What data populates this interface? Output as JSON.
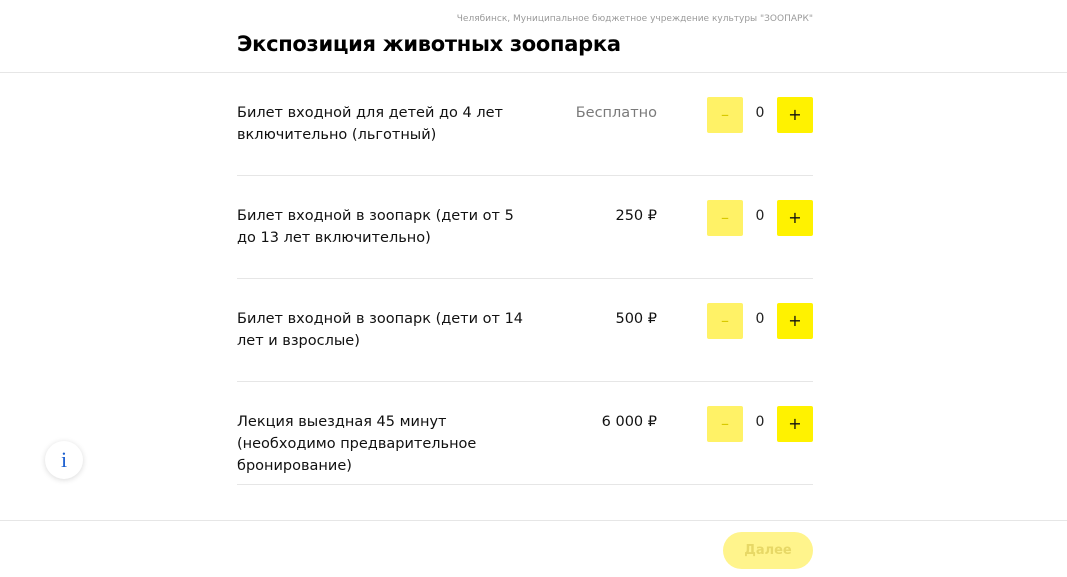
{
  "header": {
    "organization": "Челябинск, Муниципальное бюджетное учреждение культуры \"ЗООПАРК\"",
    "title": "Экспозиция животных зоопарка"
  },
  "tickets": [
    {
      "name": "Билет входной для детей до 4 лет включительно (льготный)",
      "price": "Бесплатно",
      "quantity": "0",
      "minus_label": "–",
      "plus_label": "+"
    },
    {
      "name": "Билет входной в зоопарк (дети от 5 до 13 лет включительно)",
      "price": "250 ₽",
      "quantity": "0",
      "minus_label": "–",
      "plus_label": "+"
    },
    {
      "name": "Билет входной в зоопарк (дети от 14 лет и взрослые)",
      "price": "500 ₽",
      "quantity": "0",
      "minus_label": "–",
      "plus_label": "+"
    },
    {
      "name": "Лекция выездная 45 минут (необходимо предварительное бронирование)",
      "price": "6 000 ₽",
      "quantity": "0",
      "minus_label": "–",
      "plus_label": "+"
    }
  ],
  "footer": {
    "next_label": "Далее"
  },
  "info": {
    "icon_label": "i",
    "icon": "info-icon"
  },
  "colors": {
    "accent_yellow": "#fff200",
    "accent_yellow_disabled": "#fff266",
    "info_blue": "#1a5fd0"
  }
}
